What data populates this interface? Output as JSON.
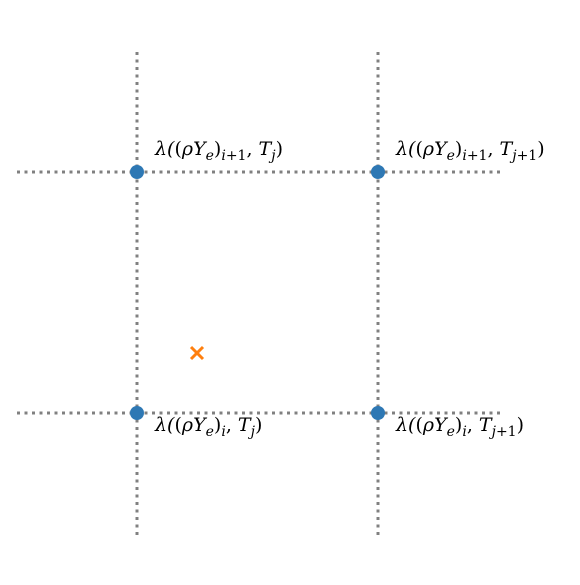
{
  "diagram": {
    "grid_color": "#808080",
    "node_color": "#2e78b4",
    "target_color": "#ff7f0e",
    "target_marker": "x-marker",
    "labels": {
      "top_left": "λ((ρYe)i+1, Tj)",
      "top_right": "λ((ρYe)i+1, Tj+1)",
      "bottom_left": "λ((ρYe)i, Tj)",
      "bottom_right": "λ((ρYe)i, Tj+1)"
    }
  }
}
